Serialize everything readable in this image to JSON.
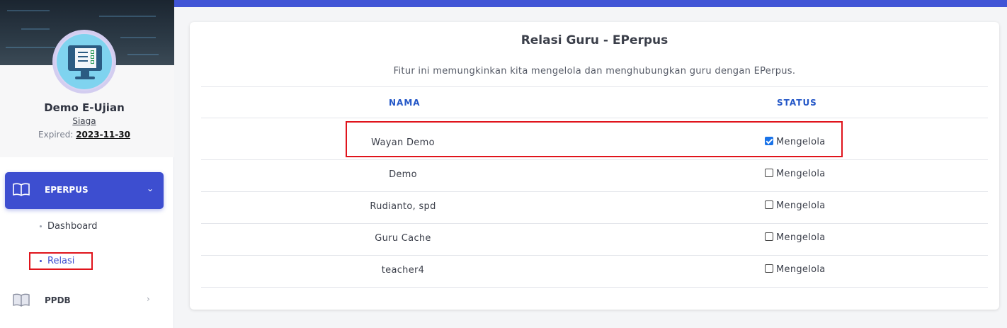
{
  "sidebar": {
    "profile": {
      "name": "Demo E-Ujian",
      "plan": "Siaga",
      "expired_label": "Expired:",
      "expired_date": "2023-11-30"
    },
    "menu": [
      {
        "label": "EPERPUS",
        "icon": "book-open-icon",
        "expanded": true,
        "children": [
          {
            "label": "Dashboard",
            "active": false
          },
          {
            "label": "Relasi",
            "active": true
          }
        ]
      },
      {
        "label": "PPDB",
        "icon": "book-open-icon",
        "expanded": false
      }
    ]
  },
  "main": {
    "title": "Relasi Guru - EPerpus",
    "description": "Fitur ini memungkinkan kita mengelola dan menghubungkan guru dengan EPerpus.",
    "table": {
      "columns": [
        "NAMA",
        "STATUS"
      ],
      "rows": [
        {
          "name": "Wayan Demo",
          "status_label": "Mengelola",
          "checked": true
        },
        {
          "name": "Demo",
          "status_label": "Mengelola",
          "checked": false
        },
        {
          "name": "Rudianto, spd",
          "status_label": "Mengelola",
          "checked": false
        },
        {
          "name": "Guru Cache",
          "status_label": "Mengelola",
          "checked": false
        },
        {
          "name": "teacher4",
          "status_label": "Mengelola",
          "checked": false
        }
      ]
    }
  },
  "colors": {
    "accent": "#3d4ed0",
    "topbar": "#4155d6",
    "header_text": "#2457c7",
    "annotation_red": "#e0141c"
  }
}
